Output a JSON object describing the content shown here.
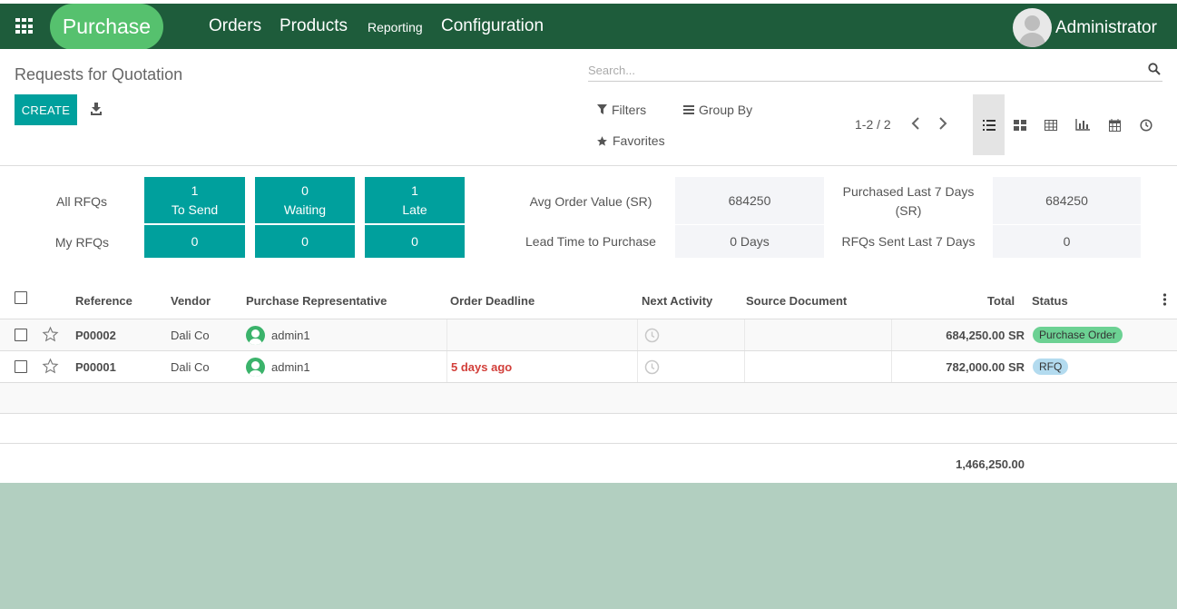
{
  "colors": {
    "navbar": "#1e5c3b",
    "brand": "#56c16e",
    "primary": "#00a09d",
    "backdrop": "#b2cfc0",
    "late_text": "#d23f3a",
    "badge_purchase_order": "#6cd193",
    "badge_rfq": "#b3dbef"
  },
  "navbar": {
    "apps_icon": "grid-icon",
    "brand": "Purchase",
    "menu": [
      "Orders",
      "Products",
      "Reporting",
      "Configuration"
    ],
    "user_name": "Administrator"
  },
  "control_panel": {
    "title": "Requests for Quotation",
    "create_label": "CREATE",
    "search_placeholder": "Search...",
    "filters_label": "Filters",
    "group_by_label": "Group By",
    "favorites_label": "Favorites",
    "pager": "1-2 / 2",
    "views": [
      "list-view-icon",
      "kanban-view-icon",
      "pivot-view-icon",
      "graph-view-icon",
      "calendar-view-icon",
      "activity-view-icon"
    ]
  },
  "dashboard": {
    "all_rfqs_label": "All RFQs",
    "my_rfqs_label": "My RFQs",
    "all": {
      "to_send_count": "1",
      "to_send_label": "To Send",
      "waiting_count": "0",
      "waiting_label": "Waiting",
      "late_count": "1",
      "late_label": "Late"
    },
    "my": {
      "to_send": "0",
      "waiting": "0",
      "late": "0"
    },
    "avg_order_value_label": "Avg Order Value (SR)",
    "avg_order_value": "684250",
    "lead_time_label": "Lead Time to Purchase",
    "lead_time": "0  Days",
    "purchased_7d_label_1": "Purchased Last 7 Days",
    "purchased_7d_label_2": "(SR)",
    "purchased_7d": "684250",
    "rfqs_sent_label": "RFQs Sent Last 7 Days",
    "rfqs_sent": "0"
  },
  "table": {
    "headers": {
      "reference": "Reference",
      "vendor": "Vendor",
      "rep": "Purchase Representative",
      "deadline": "Order Deadline",
      "activity": "Next Activity",
      "source": "Source Document",
      "total": "Total",
      "status": "Status"
    },
    "rows": [
      {
        "reference": "P00002",
        "vendor": "Dali Co",
        "rep": "admin1",
        "deadline": "",
        "source": "",
        "total": "684,250.00 SR",
        "status": "Purchase Order"
      },
      {
        "reference": "P00001",
        "vendor": "Dali Co",
        "rep": "admin1",
        "deadline": "5 days ago",
        "source": "",
        "total": "782,000.00 SR",
        "status": "RFQ"
      }
    ],
    "grand_total": "1,466,250.00"
  }
}
